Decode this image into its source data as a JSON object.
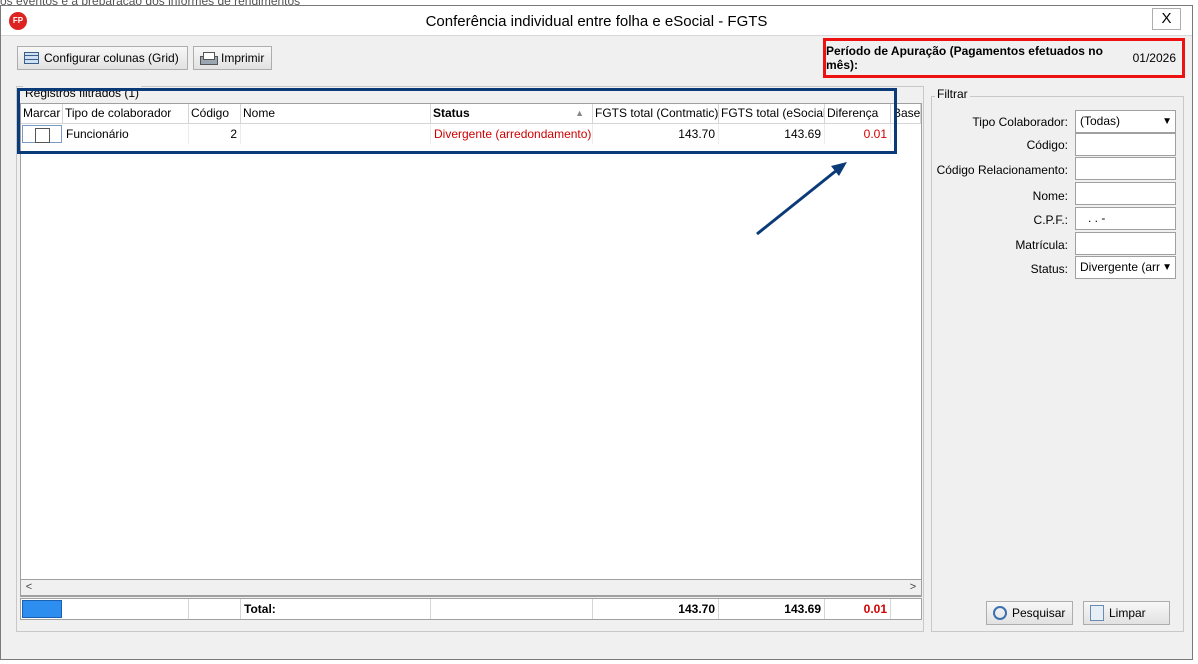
{
  "background_text": "os eventos e a preparação dos informes de rendimentos",
  "window": {
    "title": "Conferência individual entre folha e eSocial - FGTS",
    "app_icon_label": "FP",
    "close_label": "X"
  },
  "toolbar": {
    "config_columns_label": "Configurar colunas (Grid)",
    "print_label": "Imprimir"
  },
  "periodo": {
    "label": "Período de Apuração (Pagamentos efetuados no mês):",
    "value": "01/2026"
  },
  "grid": {
    "group_title": "Registros filtrados (1)",
    "columns": [
      "Marcar",
      "Tipo de colaborador",
      "Código",
      "Nome",
      "Status",
      "FGTS total (Contmatic)",
      "FGTS total (eSocial)",
      "Diferença",
      "Base"
    ],
    "rows": [
      {
        "tipo": "Funcionário",
        "codigo": "2",
        "nome": "",
        "status": "Divergente (arredondamento)",
        "fgts_contmatic": "143.70",
        "fgts_esocial": "143.69",
        "diferenca": "0.01"
      }
    ],
    "totals": {
      "label": "Total:",
      "fgts_contmatic": "143.70",
      "fgts_esocial": "143.69",
      "diferenca": "0.01"
    }
  },
  "filter": {
    "group_title": "Filtrar",
    "tipo_label": "Tipo Colaborador:",
    "tipo_value": "(Todas)",
    "codigo_label": "Código:",
    "codigo_value": "",
    "codigo_rel_label": "Código Relacionamento:",
    "codigo_rel_value": "",
    "nome_label": "Nome:",
    "nome_value": "",
    "cpf_label": "C.P.F.:",
    "cpf_value": ". . -",
    "matricula_label": "Matrícula:",
    "matricula_value": "",
    "status_label": "Status:",
    "status_value": "Divergente (arr",
    "search_label": "Pesquisar",
    "clear_label": "Limpar"
  },
  "colors": {
    "highlight_red": "#ee1111",
    "highlight_blue": "#0a3a78",
    "divergent_text": "#d00000"
  }
}
